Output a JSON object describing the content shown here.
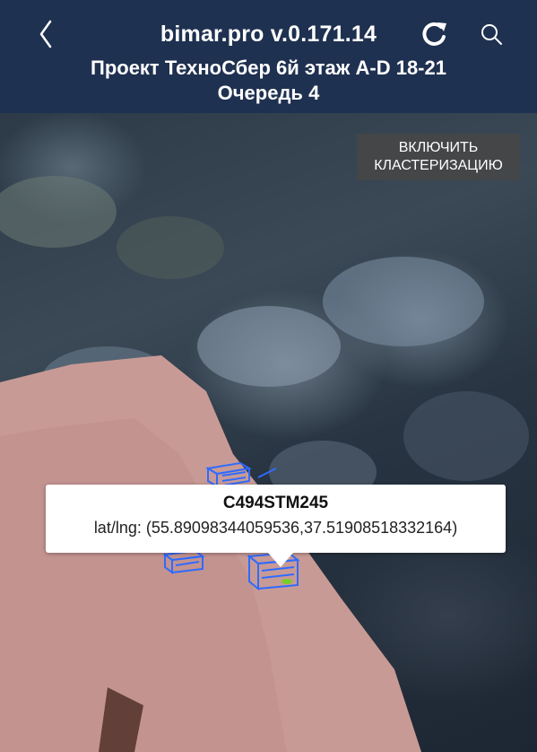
{
  "header": {
    "title": "bimar.pro v.0.171.14",
    "subtitle_line1": "Проект ТехноСбер 6й этаж A-D 18-21",
    "subtitle_line2": "Очередь 4",
    "back_icon": "chevron-left-icon",
    "refresh_icon": "refresh-icon",
    "search_icon": "search-icon"
  },
  "map": {
    "cluster_button_line1": "ВКЛЮЧИТЬ",
    "cluster_button_line2": "КЛАСТЕРИЗАЦИЮ",
    "marker_color": "#2f6bff",
    "popup": {
      "title": "C494STM245",
      "coords": "lat/lng: (55.89098344059536,37.51908518332164)"
    }
  },
  "colors": {
    "header_bg": "#1f3150",
    "building_pink": "#c89a96"
  }
}
